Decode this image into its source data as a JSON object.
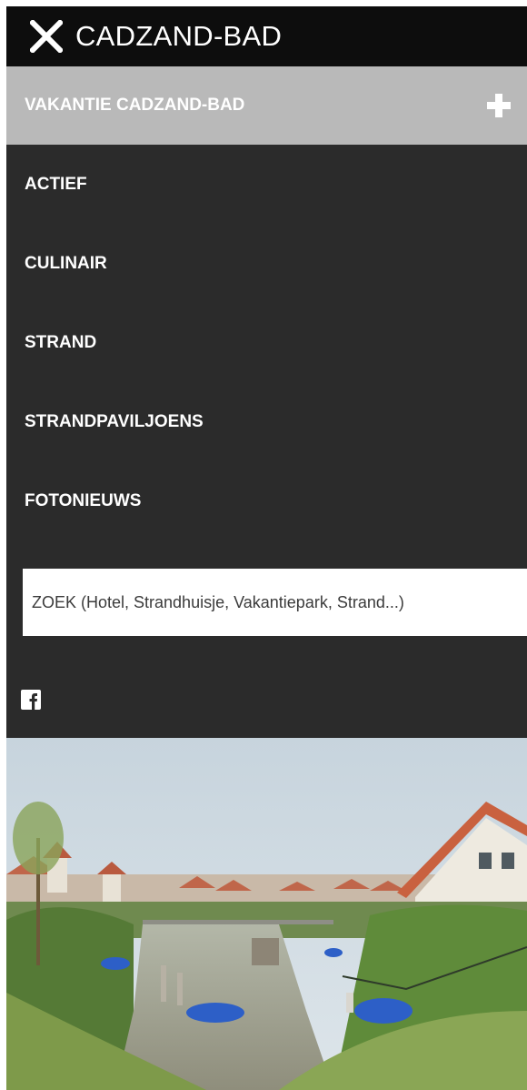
{
  "header": {
    "title": "CADZAND-BAD",
    "close_icon": "close-icon"
  },
  "section": {
    "label": "VAKANTIE CADZAND-BAD",
    "expand_icon": "plus-icon"
  },
  "menu": {
    "items": [
      {
        "label": "ACTIEF"
      },
      {
        "label": "CULINAIR"
      },
      {
        "label": "STRAND"
      },
      {
        "label": "STRANDPAVILJOENS"
      },
      {
        "label": "FOTONIEUWS"
      }
    ]
  },
  "search": {
    "value": "",
    "placeholder": "ZOEK (Hotel, Strandhuisje, Vakantiepark, Strand...)"
  },
  "social": {
    "icon": "facebook-icon"
  },
  "colors": {
    "header_bg": "#0d0d0d",
    "section_bg": "#b9b9b9",
    "menu_bg": "#2b2b2b",
    "text": "#ffffff"
  }
}
